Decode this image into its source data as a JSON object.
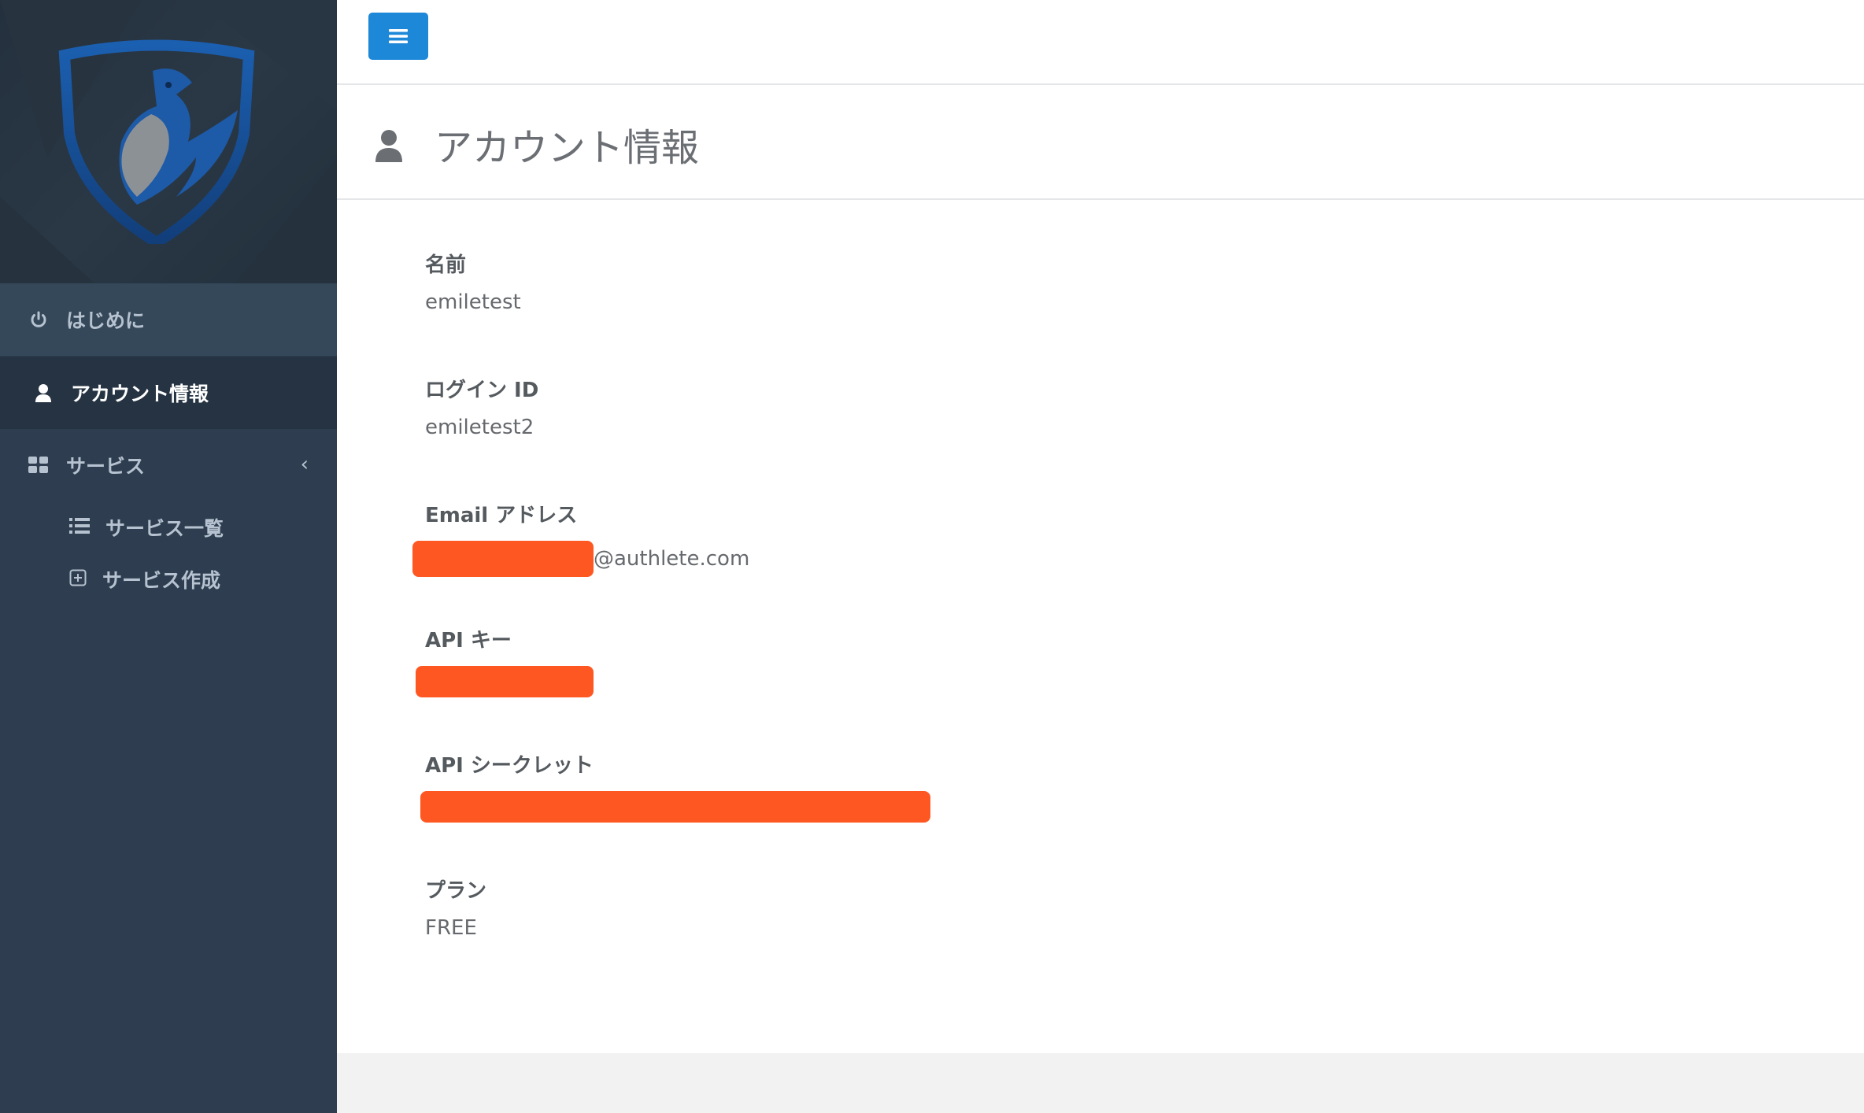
{
  "sidebar": {
    "items": [
      {
        "label": "はじめに",
        "icon": "power-icon"
      },
      {
        "label": "アカウント情報",
        "icon": "user-icon"
      },
      {
        "label": "サービス",
        "icon": "grid-icon"
      }
    ],
    "sub_items": [
      {
        "label": "サービス一覧",
        "icon": "list-icon"
      },
      {
        "label": "サービス作成",
        "icon": "plus-square-icon"
      }
    ]
  },
  "header": {
    "title": "アカウント情報"
  },
  "fields": {
    "name": {
      "label": "名前",
      "value": "emiletest"
    },
    "login_id": {
      "label": "ログイン ID",
      "value": "emiletest2"
    },
    "email": {
      "label": "Email アドレス",
      "value_suffix": "@authlete.com"
    },
    "api_key": {
      "label": "API キー"
    },
    "api_secret": {
      "label": "API シークレット"
    },
    "plan": {
      "label": "プラン",
      "value": "FREE"
    }
  },
  "colors": {
    "sidebar_bg": "#2e3e50",
    "accent": "#1e88d8",
    "redaction": "#ff5722"
  }
}
